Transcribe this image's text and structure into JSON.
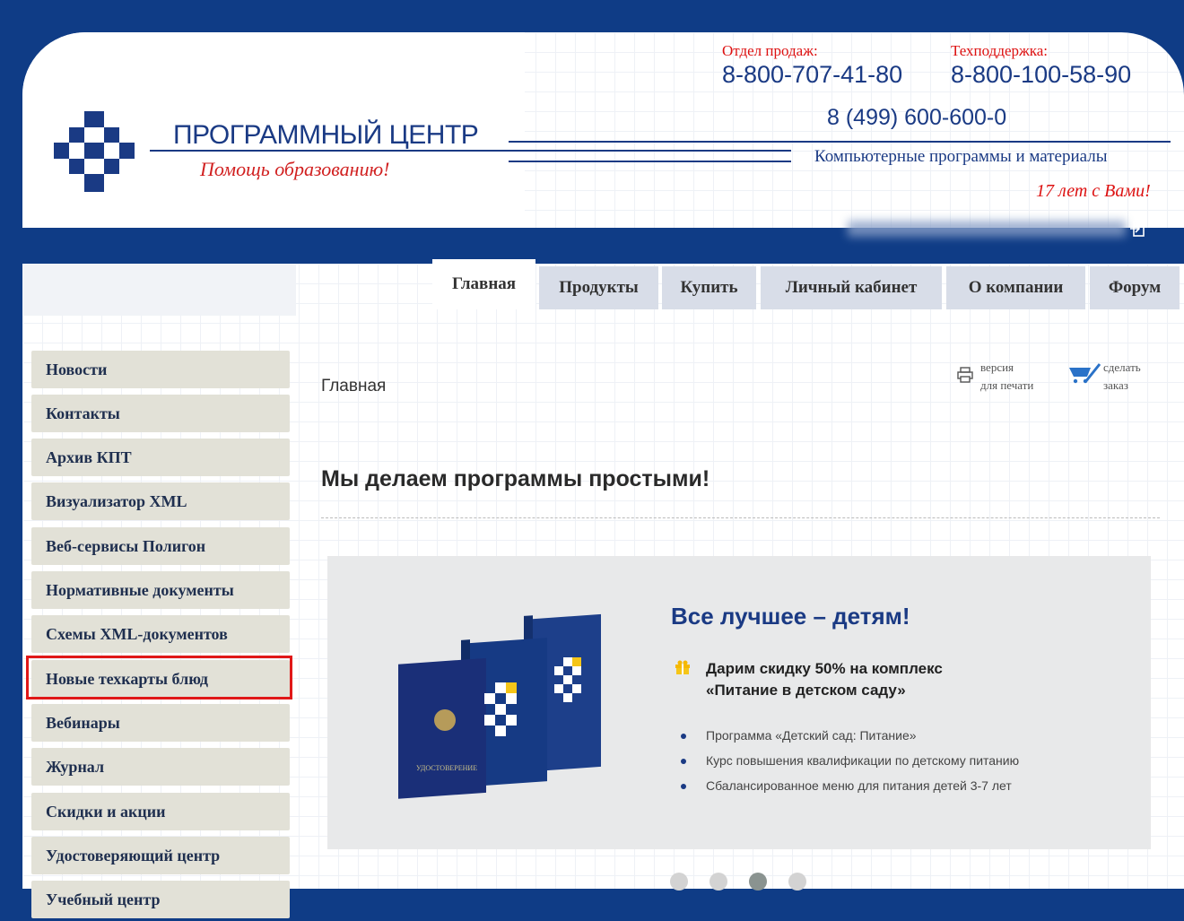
{
  "header": {
    "company_name": "ПРОГРАММНЫЙ ЦЕНТР",
    "slogan": "Помощь образованию!",
    "sales_label": "Отдел продаж:",
    "sales_phone": "8-800-707-41-80",
    "support_label": "Техподдержка:",
    "support_phone": "8-800-100-58-90",
    "main_phone": "8 (499) 600-600-0",
    "tagline": "Компьютерные программы и материалы",
    "years": "17 лет с Вами!"
  },
  "topbar": {
    "user_blurred": "user",
    "logout_icon": "logout-icon"
  },
  "nav": {
    "tabs": [
      {
        "label": "Главная",
        "active": true
      },
      {
        "label": "Продукты",
        "active": false
      },
      {
        "label": "Купить",
        "active": false
      },
      {
        "label": "Личный кабинет",
        "active": false
      },
      {
        "label": "О компании",
        "active": false
      },
      {
        "label": "Форум",
        "active": false
      }
    ]
  },
  "sidebar": {
    "items": [
      {
        "label": "Новости"
      },
      {
        "label": "Контакты"
      },
      {
        "label": "Архив КПТ"
      },
      {
        "label": "Визуализатор XML"
      },
      {
        "label": "Веб-сервисы Полигон"
      },
      {
        "label": "Нормативные документы"
      },
      {
        "label": "Схемы XML-документов"
      },
      {
        "label": "Новые техкарты блюд",
        "highlighted": true
      },
      {
        "label": "Вебинары"
      },
      {
        "label": "Журнал"
      },
      {
        "label": "Скидки и акции"
      },
      {
        "label": "Удостоверяющий центр"
      },
      {
        "label": "Учебный центр"
      }
    ]
  },
  "main": {
    "breadcrumb": "Главная",
    "print_line1": "версия",
    "print_line2": "для печати",
    "order_line1": "сделать",
    "order_line2": "заказ",
    "title": "Мы делаем программы простыми!"
  },
  "banner": {
    "title": "Все лучшее – детям!",
    "offer_line1": "Дарим скидку 50% на комплекс",
    "offer_line2": "«Питание в детском саду»",
    "bullets": [
      "Программа «Детский сад: Питание»",
      "Курс повышения квалификации по детскому питанию",
      "Сбалансированное меню для питания детей 3-7 лет"
    ],
    "cert_label": "УДОСТОВЕРЕНИЕ",
    "slider_dots": 4,
    "active_dot": 3
  },
  "colors": {
    "brand_blue": "#0f3c86",
    "accent_red": "#d11111",
    "sidebar_bg": "#e2e1d7",
    "highlight": "#e01818"
  }
}
